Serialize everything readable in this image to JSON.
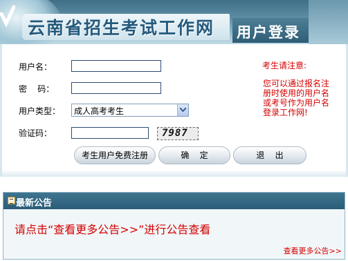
{
  "header": {
    "title": "云南省招生考试工作网",
    "subtitle": "用户登录"
  },
  "login_form": {
    "username_label": "用户名：",
    "username_value": "",
    "password_label": "密    码：",
    "password_value": "",
    "user_type_label": "用户类型：",
    "user_type_selected": "成人高考考生",
    "captcha_label": "验证码：",
    "captcha_value": "",
    "captcha_image_text": "7987",
    "register_button": "考生用户免费注册",
    "confirm_button": "确    定",
    "exit_button": "退    出"
  },
  "notice": {
    "title": "考生请注意:",
    "body": "您可以通过报名注册时使用的用户名或考号作为用户名登录工作网!"
  },
  "announcement": {
    "title": "最新公告",
    "message": "请点击“查看更多公告>>”进行公告查看",
    "more_link": "查看更多公告>>"
  },
  "colors": {
    "header_blue": "#3f6f87",
    "notice_red": "#d40000",
    "announce_bar": "#2a5d78"
  }
}
